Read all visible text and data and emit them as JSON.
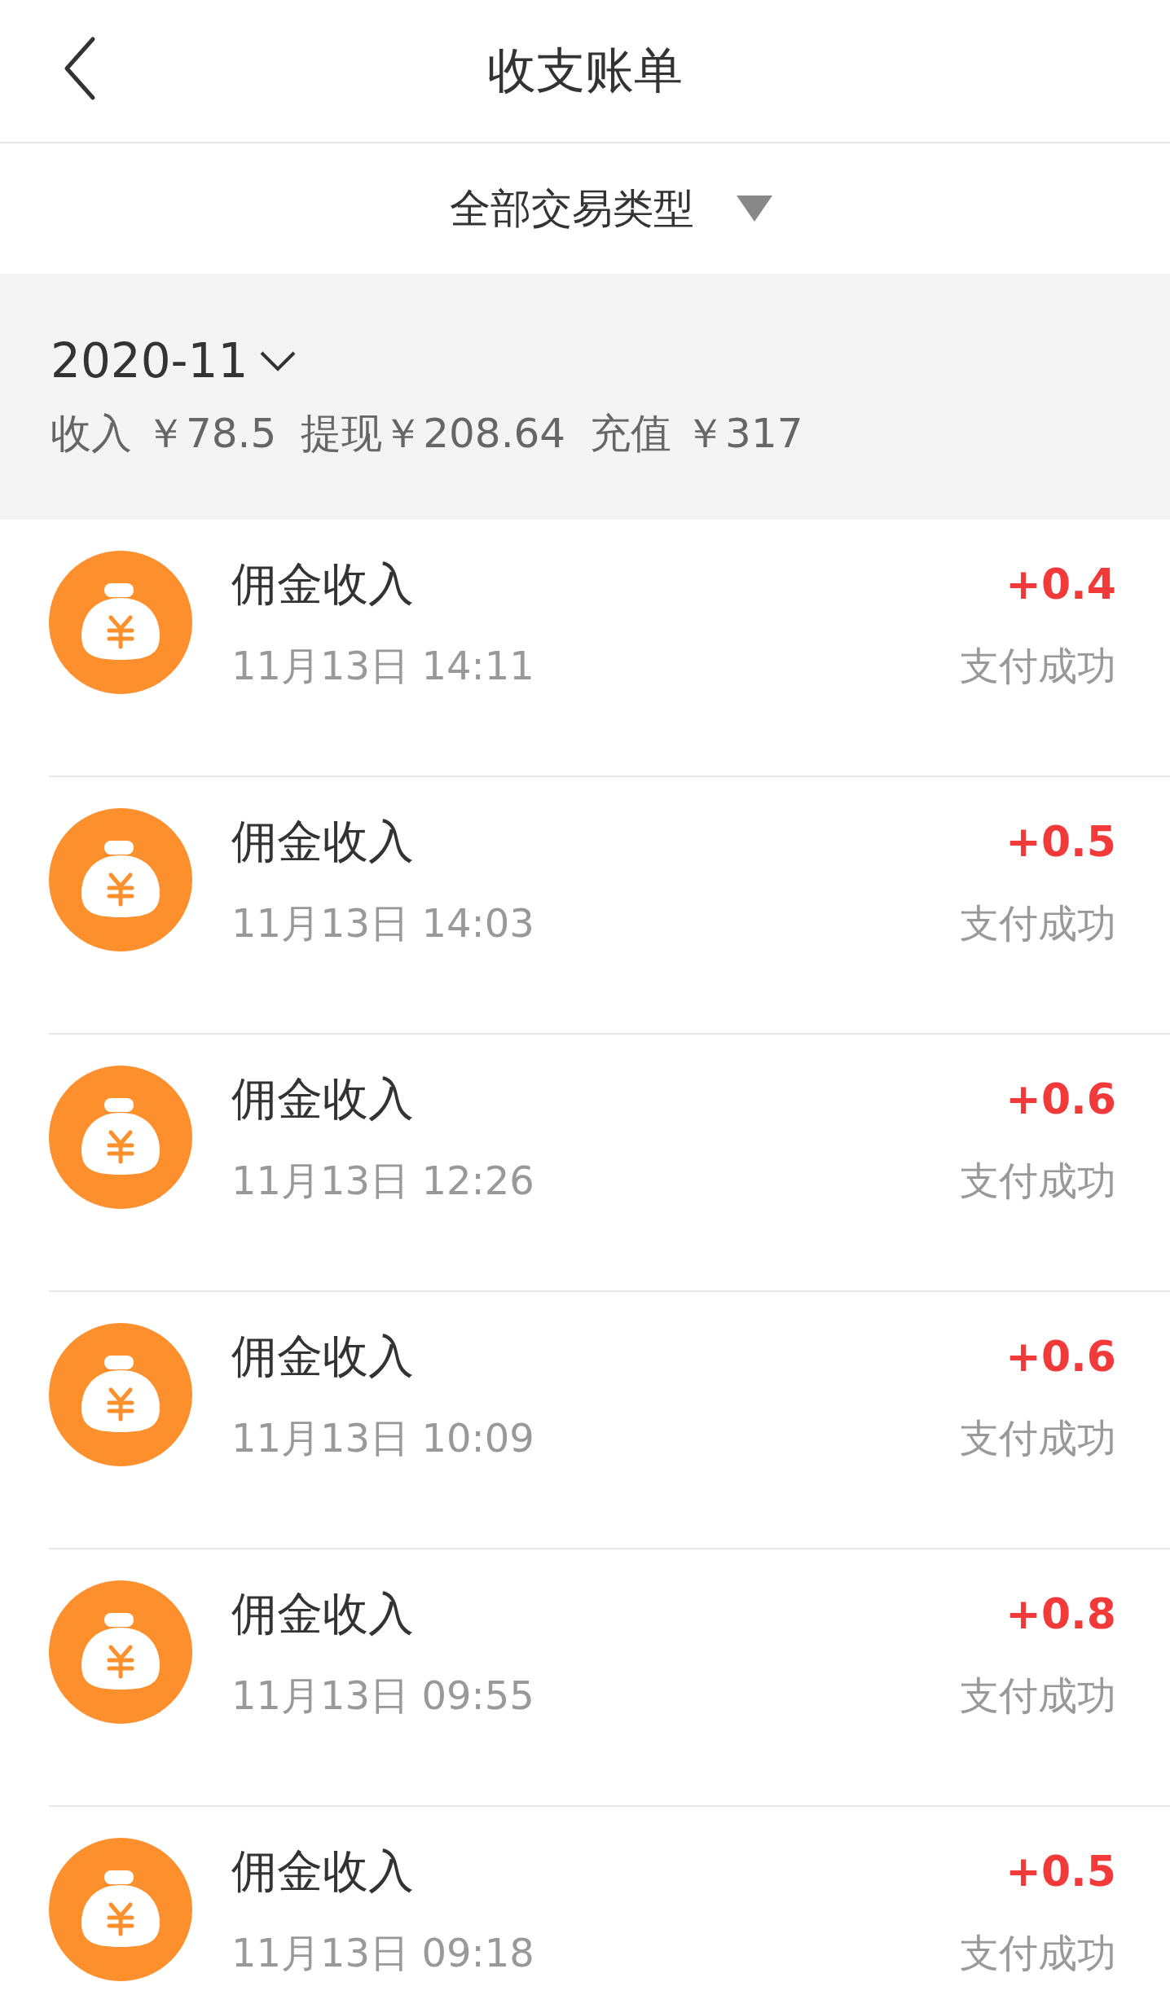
{
  "header": {
    "title": "收支账单"
  },
  "filter": {
    "label": "全部交易类型"
  },
  "summary": {
    "month": "2020-11",
    "totals": [
      "收入 ￥78.5",
      "提现￥208.64",
      "充值 ￥317"
    ]
  },
  "transactions": [
    {
      "title": "佣金收入",
      "time": "11月13日 14:11",
      "amount": "+0.4",
      "status": "支付成功"
    },
    {
      "title": "佣金收入",
      "time": "11月13日 14:03",
      "amount": "+0.5",
      "status": "支付成功"
    },
    {
      "title": "佣金收入",
      "time": "11月13日 12:26",
      "amount": "+0.6",
      "status": "支付成功"
    },
    {
      "title": "佣金收入",
      "time": "11月13日 10:09",
      "amount": "+0.6",
      "status": "支付成功"
    },
    {
      "title": "佣金收入",
      "time": "11月13日 09:55",
      "amount": "+0.8",
      "status": "支付成功"
    },
    {
      "title": "佣金收入",
      "time": "11月13日 09:18",
      "amount": "+0.5",
      "status": "支付成功"
    }
  ]
}
